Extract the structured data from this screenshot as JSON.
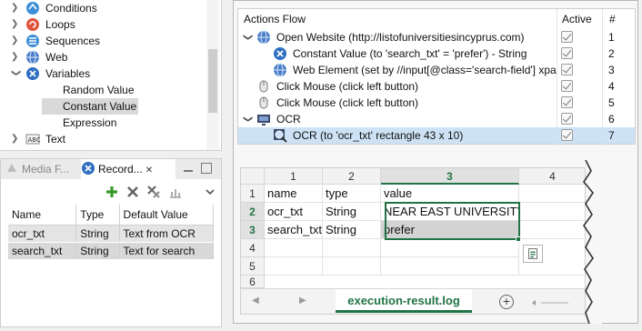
{
  "tree": {
    "items": [
      {
        "label": "Conditions",
        "icon": "conditions-icon",
        "expanded": false
      },
      {
        "label": "Loops",
        "icon": "loops-icon",
        "expanded": false
      },
      {
        "label": "Sequences",
        "icon": "sequences-icon",
        "expanded": false
      },
      {
        "label": "Web",
        "icon": "web-globe-icon",
        "expanded": false
      },
      {
        "label": "Variables",
        "icon": "variables-x-icon",
        "expanded": true
      },
      {
        "label": "Random Value",
        "child": true
      },
      {
        "label": "Constant Value",
        "child": true,
        "selected": true
      },
      {
        "label": "Expression",
        "child": true
      },
      {
        "label": "Text",
        "icon": "text-abc-icon",
        "expanded": false
      }
    ]
  },
  "tabs": {
    "media_label": "Media F...",
    "record_label": "Record..."
  },
  "records": {
    "columns": [
      "Name",
      "Type",
      "Default Value"
    ],
    "rows": [
      [
        "ocr_txt",
        "String",
        "Text from OCR"
      ],
      [
        "search_txt",
        "String",
        "Text for search"
      ]
    ]
  },
  "flow": {
    "header": {
      "title": "Actions Flow",
      "active": "Active",
      "num": "#"
    },
    "rows": [
      {
        "label": "Open Website (http://listofuniversitiesincyprus.com)",
        "icon": "globe-icon",
        "num": "1",
        "depth": 0,
        "chevron": true
      },
      {
        "label": "Constant Value (to 'search_txt' = 'prefer') - String",
        "icon": "variable-x-icon",
        "num": "2",
        "depth": 1
      },
      {
        "label": "Web Element (set by //input[@class='search-field'] xpa",
        "icon": "globe-icon",
        "num": "3",
        "depth": 1
      },
      {
        "label": "Click Mouse (click left button)",
        "icon": "mouse-icon",
        "num": "4",
        "depth": 0
      },
      {
        "label": "Click Mouse (click left button)",
        "icon": "mouse-icon",
        "num": "5",
        "depth": 0
      },
      {
        "label": "OCR",
        "icon": "ocr-monitor-icon",
        "num": "6",
        "depth": 0,
        "chevron": true
      },
      {
        "label": "OCR (to 'ocr_txt' rectangle 43 x 10)",
        "icon": "ocr-magnifier-icon",
        "num": "7",
        "depth": 1,
        "selected": true
      }
    ]
  },
  "sheet": {
    "col_headers": [
      "1",
      "2",
      "3",
      "4"
    ],
    "row_headers": [
      "1",
      "2",
      "3",
      "4",
      "5",
      "6",
      "7"
    ],
    "rows": [
      [
        "name",
        "type",
        "value"
      ],
      [
        "ocr_txt",
        "String",
        "NEAR EAST UNIVERSITY"
      ],
      [
        "search_txt",
        "String",
        "prefer"
      ]
    ],
    "tab_label": "execution-result.log",
    "accent": "#217346"
  }
}
